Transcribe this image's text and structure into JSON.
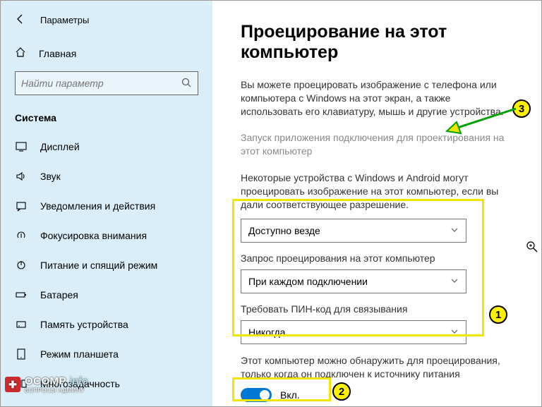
{
  "window": {
    "title": "Параметры"
  },
  "sidebar": {
    "home": "Главная",
    "search_placeholder": "Найти параметр",
    "section": "Система",
    "items": [
      {
        "label": "Дисплей"
      },
      {
        "label": "Звук"
      },
      {
        "label": "Уведомления и действия"
      },
      {
        "label": "Фокусировка внимания"
      },
      {
        "label": "Питание и спящий режим"
      },
      {
        "label": "Батарея"
      },
      {
        "label": "Память устройства"
      },
      {
        "label": "Режим планшета"
      },
      {
        "label": "Многозадачность"
      }
    ]
  },
  "main": {
    "title": "Проецирование на этот компьютер",
    "desc": "Вы можете проецировать изображение с телефона или компьютера с Windows на этот экран, а также использовать его клавиатуру, мышь и другие устройства.",
    "link_launch": "Запуск приложения подключения для проектирования на этот компьютер",
    "desc2": "Некоторые устройства с Windows и Android могут проецировать изображение на этот компьютер, если вы дали соответствующее разрешение.",
    "select1_value": "Доступно везде",
    "field2_label": "Запрос проецирования на этот компьютер",
    "select2_value": "При каждом подключении",
    "field3_label": "Требовать ПИН-код для связывания",
    "select3_value": "Никогда",
    "discover_note": "Этот компьютер можно обнаружить для проецирования, только когда он подключен к источнику питания",
    "toggle_label": "Вкл."
  },
  "annotations": {
    "badge1": "1",
    "badge2": "2",
    "badge3": "3"
  },
  "watermark": {
    "main": "OCOMP",
    "suffix": ".info",
    "sub": "ВОПРОСЫ АДМИНУ"
  }
}
